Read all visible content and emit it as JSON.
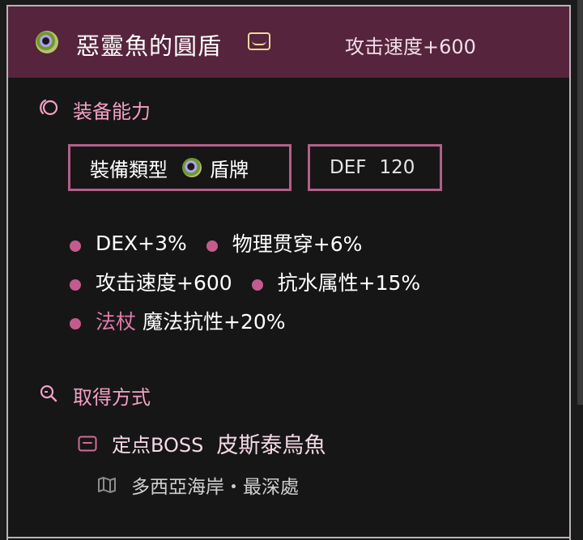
{
  "header": {
    "title": "惡靈魚的圓盾",
    "stat": "攻击速度+600"
  },
  "equip": {
    "section_label": "装备能力",
    "type_label": "裝備類型",
    "type_value": "盾牌",
    "def_label": "DEF",
    "def_value": "120"
  },
  "stats": [
    {
      "text": "DEX+3%"
    },
    {
      "text": "物理贯穿+6%"
    },
    {
      "text": "攻击速度+600"
    },
    {
      "text": "抗水属性+15%"
    },
    {
      "tag": "法杖",
      "text": "魔法抗性+20%"
    }
  ],
  "acquisition": {
    "section_label": "取得方式",
    "source_label": "定点BOSS",
    "source_name": "皮斯泰烏魚",
    "location": "多西亞海岸・最深處"
  },
  "colors": {
    "header_bg": "#56243c",
    "accent_pink": "#f2a0c4",
    "chip_border": "#b35f87",
    "bullet": "#c45b8e",
    "chest_icon": "#f4d89c"
  },
  "icons": [
    "item-icon",
    "chest-icon",
    "ring-icon",
    "search-icon",
    "box-icon",
    "map-icon"
  ]
}
